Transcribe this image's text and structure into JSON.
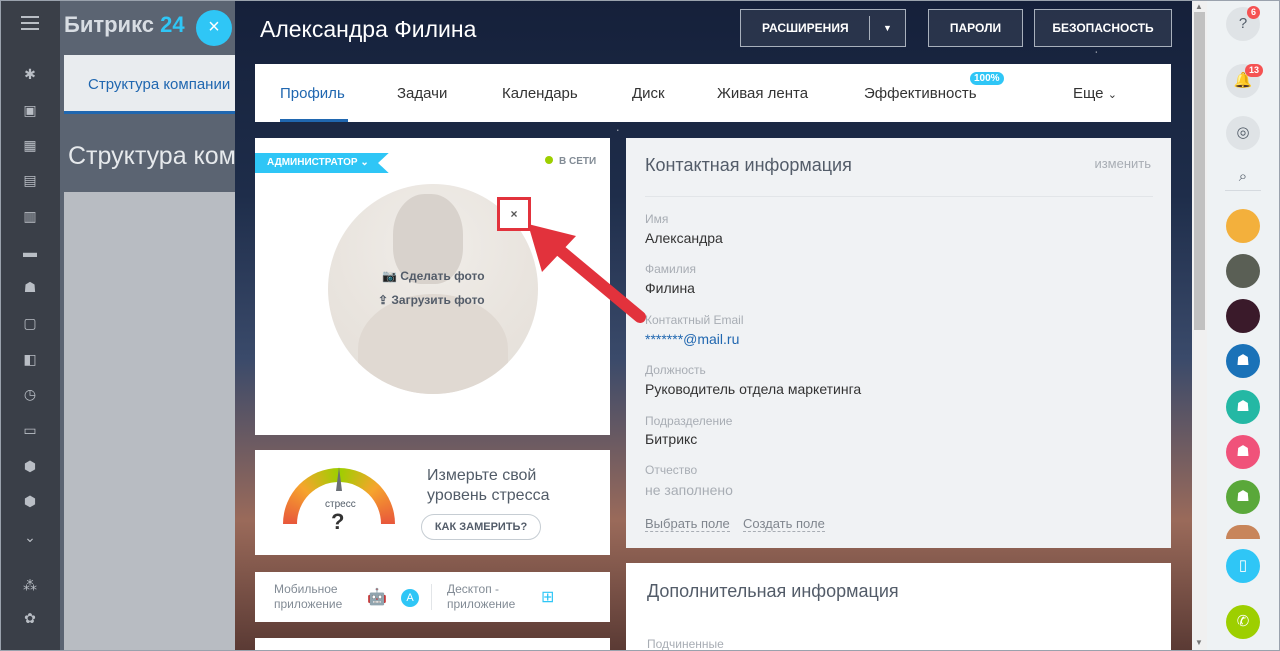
{
  "bg_app": {
    "logo": "Битрикс 24",
    "logo_main": "Битрикс",
    "logo_num": "24",
    "tab": "Структура компании",
    "heading": "Структура компании"
  },
  "header": {
    "title": "Александра Филина",
    "extensions_label": "РАСШИРЕНИЯ",
    "passwords_label": "ПАРОЛИ",
    "security_label": "БЕЗОПАСНОСТЬ"
  },
  "tabs": [
    {
      "label": "Профиль",
      "active": true
    },
    {
      "label": "Задачи"
    },
    {
      "label": "Календарь"
    },
    {
      "label": "Диск"
    },
    {
      "label": "Живая лента"
    },
    {
      "label": "Эффективность",
      "badge": "100%"
    },
    {
      "label": "Еще"
    }
  ],
  "profile": {
    "role_badge": "АДМИНИСТРАТОР",
    "status": "В СЕТИ",
    "take_photo": "Сделать фото",
    "upload_photo": "Загрузить фото",
    "delete_symbol": "×"
  },
  "stress": {
    "gauge_label": "стресс",
    "gauge_value": "?",
    "text": "Измерьте свой уровень стресса",
    "button": "КАК ЗАМЕРИТЬ?"
  },
  "apps": {
    "mobile": "Мобильное приложение",
    "desktop": "Десктоп - приложение"
  },
  "contact": {
    "title": "Контактная информация",
    "edit": "изменить",
    "fields": [
      {
        "label": "Имя",
        "value": "Александра"
      },
      {
        "label": "Фамилия",
        "value": "Филина"
      },
      {
        "label": "Контактный Email",
        "value": "*******@mail.ru"
      },
      {
        "label": "Должность",
        "value": "Руководитель отдела маркетинга"
      },
      {
        "label": "Подразделение",
        "value": "Битрикс"
      },
      {
        "label": "Отчество",
        "value": "не заполнено"
      }
    ],
    "choose_field": "Выбрать поле",
    "create_field": "Создать поле"
  },
  "additional": {
    "title": "Дополнительная информация",
    "subordinates": "Подчиненные"
  },
  "right_bar": {
    "help_badge": "6",
    "notify_badge": "13"
  },
  "colors": {
    "accent": "#2fc6f6",
    "link": "#2067b0",
    "highlight": "#e2323c",
    "online": "#9dcf00"
  }
}
